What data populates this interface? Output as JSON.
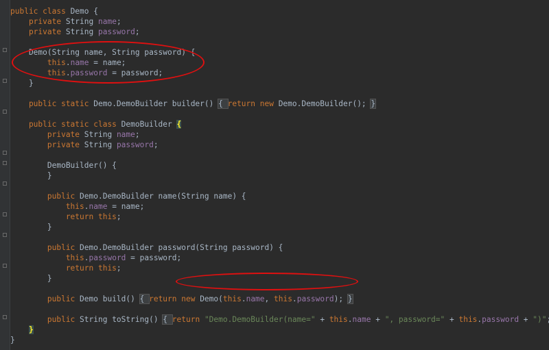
{
  "editor": {
    "lines": [
      [
        {
          "t": "public class ",
          "c": "kw"
        },
        {
          "t": "Demo {",
          "c": ""
        }
      ],
      [
        {
          "t": "    private ",
          "c": "kw"
        },
        {
          "t": "String ",
          "c": ""
        },
        {
          "t": "name",
          "c": "fld"
        },
        {
          "t": ";",
          "c": ""
        }
      ],
      [
        {
          "t": "    private ",
          "c": "kw"
        },
        {
          "t": "String ",
          "c": ""
        },
        {
          "t": "password",
          "c": "fld"
        },
        {
          "t": ";",
          "c": ""
        }
      ],
      [],
      [
        {
          "t": "    Demo(String name, String password) {",
          "c": ""
        }
      ],
      [
        {
          "t": "        this",
          "c": "kw"
        },
        {
          "t": ".",
          "c": ""
        },
        {
          "t": "name",
          "c": "fld"
        },
        {
          "t": " = name;",
          "c": ""
        }
      ],
      [
        {
          "t": "        this",
          "c": "kw"
        },
        {
          "t": ".",
          "c": ""
        },
        {
          "t": "password",
          "c": "fld"
        },
        {
          "t": " = password;",
          "c": ""
        }
      ],
      [
        {
          "t": "    }",
          "c": ""
        }
      ],
      [],
      [
        {
          "t": "    public static ",
          "c": "kw"
        },
        {
          "t": "Demo.DemoBuilder builder() ",
          "c": ""
        },
        {
          "t": "{ ",
          "c": "fold-hl"
        },
        {
          "t": "return new ",
          "c": "kw"
        },
        {
          "t": "Demo.DemoBuilder(); ",
          "c": ""
        },
        {
          "t": "}",
          "c": "fold-hl"
        }
      ],
      [],
      [
        {
          "t": "    public static class ",
          "c": "kw"
        },
        {
          "t": "DemoBuilder ",
          "c": ""
        },
        {
          "t": "{",
          "c": "brace-match"
        }
      ],
      [
        {
          "t": "        private ",
          "c": "kw"
        },
        {
          "t": "String ",
          "c": ""
        },
        {
          "t": "name",
          "c": "fld"
        },
        {
          "t": ";",
          "c": ""
        }
      ],
      [
        {
          "t": "        private ",
          "c": "kw"
        },
        {
          "t": "String ",
          "c": ""
        },
        {
          "t": "password",
          "c": "fld"
        },
        {
          "t": ";",
          "c": ""
        }
      ],
      [],
      [
        {
          "t": "        DemoBuilder() {",
          "c": ""
        }
      ],
      [
        {
          "t": "        }",
          "c": ""
        }
      ],
      [],
      [
        {
          "t": "        public ",
          "c": "kw"
        },
        {
          "t": "Demo.DemoBuilder name(String name) {",
          "c": ""
        }
      ],
      [
        {
          "t": "            this",
          "c": "kw"
        },
        {
          "t": ".",
          "c": ""
        },
        {
          "t": "name",
          "c": "fld"
        },
        {
          "t": " = name;",
          "c": ""
        }
      ],
      [
        {
          "t": "            return this",
          "c": "kw"
        },
        {
          "t": ";",
          "c": ""
        }
      ],
      [
        {
          "t": "        }",
          "c": ""
        }
      ],
      [],
      [
        {
          "t": "        public ",
          "c": "kw"
        },
        {
          "t": "Demo.DemoBuilder password(String password) {",
          "c": ""
        }
      ],
      [
        {
          "t": "            this",
          "c": "kw"
        },
        {
          "t": ".",
          "c": ""
        },
        {
          "t": "password",
          "c": "fld"
        },
        {
          "t": " = password;",
          "c": ""
        }
      ],
      [
        {
          "t": "            return this",
          "c": "kw"
        },
        {
          "t": ";",
          "c": ""
        }
      ],
      [
        {
          "t": "        }",
          "c": ""
        }
      ],
      [],
      [
        {
          "t": "        public ",
          "c": "kw"
        },
        {
          "t": "Demo build() ",
          "c": ""
        },
        {
          "t": "{ ",
          "c": "fold-hl"
        },
        {
          "t": "return new ",
          "c": "kw"
        },
        {
          "t": "Demo(",
          "c": ""
        },
        {
          "t": "this",
          "c": "kw"
        },
        {
          "t": ".",
          "c": ""
        },
        {
          "t": "name",
          "c": "fld"
        },
        {
          "t": ", ",
          "c": ""
        },
        {
          "t": "this",
          "c": "kw"
        },
        {
          "t": ".",
          "c": ""
        },
        {
          "t": "password",
          "c": "fld"
        },
        {
          "t": "); ",
          "c": ""
        },
        {
          "t": "}",
          "c": "fold-hl"
        }
      ],
      [],
      [
        {
          "t": "        public ",
          "c": "kw"
        },
        {
          "t": "String toString() ",
          "c": ""
        },
        {
          "t": "{ ",
          "c": "fold-hl"
        },
        {
          "t": "return ",
          "c": "kw"
        },
        {
          "t": "\"Demo.DemoBuilder(name=\"",
          "c": "str"
        },
        {
          "t": " + ",
          "c": ""
        },
        {
          "t": "this",
          "c": "kw"
        },
        {
          "t": ".",
          "c": ""
        },
        {
          "t": "name",
          "c": "fld"
        },
        {
          "t": " + ",
          "c": ""
        },
        {
          "t": "\", password=\"",
          "c": "str"
        },
        {
          "t": " + ",
          "c": ""
        },
        {
          "t": "this",
          "c": "kw"
        },
        {
          "t": ".",
          "c": ""
        },
        {
          "t": "password",
          "c": "fld"
        },
        {
          "t": " + ",
          "c": ""
        },
        {
          "t": "\")\"",
          "c": "str"
        },
        {
          "t": "; ",
          "c": ""
        },
        {
          "t": "}",
          "c": "fold-hl"
        }
      ],
      [
        {
          "t": "    ",
          "c": ""
        },
        {
          "t": "}",
          "c": "brace-match"
        }
      ],
      [
        {
          "t": "}",
          "c": ""
        }
      ]
    ]
  },
  "colors": {
    "background": "#2b2b2b",
    "keyword": "#cc7832",
    "field": "#9876aa",
    "string": "#6a8759",
    "default": "#a9b7c6",
    "annotation": "#e01010"
  }
}
